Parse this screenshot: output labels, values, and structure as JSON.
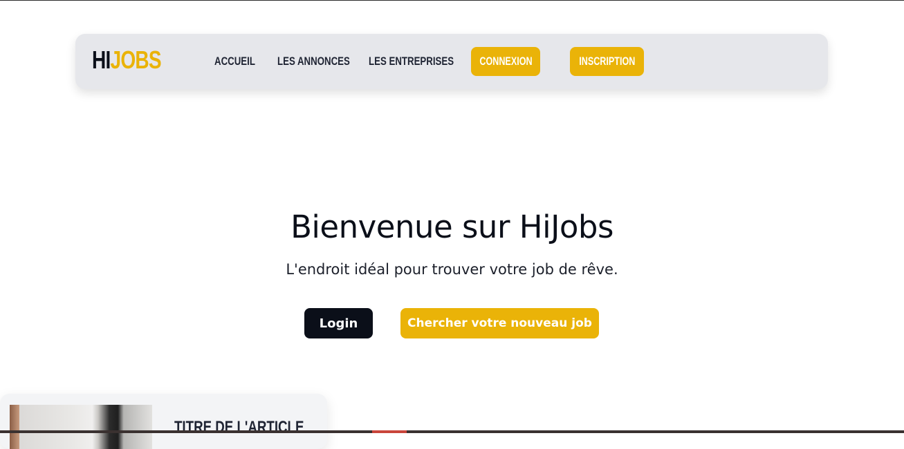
{
  "brand": {
    "logo_prefix": "HI",
    "logo_suffix": "JOBS",
    "accent_color": "#eab308",
    "dark_color": "#0b0f19"
  },
  "nav": {
    "links": [
      "ACCUEIL",
      "LES ANNONCES",
      "LES ENTREPRISES"
    ],
    "connexion_label": "CONNEXION",
    "inscription_label": "INSCRIPTION"
  },
  "hero": {
    "title": "Bienvenue sur HiJobs",
    "subtitle": "L'endroit idéal pour trouver votre job de rêve.",
    "login_label": "Login",
    "search_label": "Chercher votre nouveau job"
  },
  "article": {
    "title": "TITRE DE L'ARTICLE"
  }
}
